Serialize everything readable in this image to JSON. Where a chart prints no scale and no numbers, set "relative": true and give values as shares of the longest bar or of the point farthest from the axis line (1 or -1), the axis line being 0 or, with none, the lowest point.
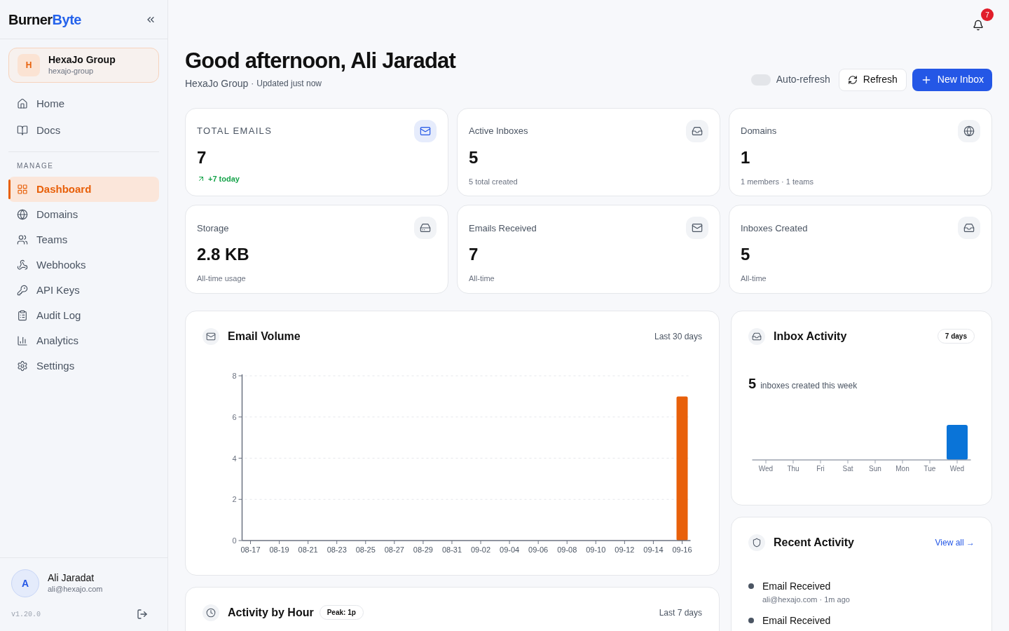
{
  "sidebar": {
    "logo": {
      "first": "Burner",
      "second": "Byte"
    },
    "org": {
      "initial": "H",
      "name": "HexaJo Group",
      "slug": "hexajo-group"
    },
    "top_items": [
      {
        "label": "Home",
        "selected": false
      },
      {
        "label": "Docs",
        "selected": false
      }
    ],
    "section_label": "MANAGE",
    "items": [
      {
        "label": "Dashboard",
        "selected": true
      },
      {
        "label": "Domains",
        "selected": false
      },
      {
        "label": "Teams",
        "selected": false
      },
      {
        "label": "Webhooks",
        "selected": false
      },
      {
        "label": "API Keys",
        "selected": false
      },
      {
        "label": "Audit Log",
        "selected": false
      },
      {
        "label": "Analytics",
        "selected": false
      },
      {
        "label": "Settings",
        "selected": false
      }
    ],
    "user": {
      "initial": "A",
      "name": "Ali Jaradat",
      "email": "ali@hexajo.com"
    },
    "version": "v1.20.0"
  },
  "notifications": {
    "count": "7"
  },
  "header": {
    "greeting": "Good afternoon, Ali Jaradat",
    "org": "HexaJo Group",
    "separator": "·",
    "updated": "Updated just now",
    "auto_refresh": {
      "label": "Auto-refresh",
      "on": false
    },
    "refresh_button": "Refresh",
    "new_inbox_button": "New Inbox"
  },
  "stats": [
    {
      "label": "TOTAL EMAILS",
      "value": "7",
      "sub": "+7 today",
      "kind": "trend",
      "highlighted": true
    },
    {
      "label": "Active Inboxes",
      "value": "5",
      "sub": "5 total created",
      "kind": "plain",
      "highlighted": false
    },
    {
      "label": "Domains",
      "value": "1",
      "sub": "1 members · 1 teams",
      "kind": "plain",
      "highlighted": false
    },
    {
      "label": "Storage",
      "value": "2.8 KB",
      "sub": "All-time usage",
      "kind": "plain",
      "highlighted": false
    },
    {
      "label": "Emails Received",
      "value": "7",
      "sub": "All-time",
      "kind": "plain",
      "highlighted": false
    },
    {
      "label": "Inboxes Created",
      "value": "5",
      "sub": "All-time",
      "kind": "plain",
      "highlighted": false
    }
  ],
  "email_volume": {
    "title": "Email Volume",
    "range": "Last 30 days",
    "chart_data": {
      "type": "bar",
      "categories": [
        "08-17",
        "08-19",
        "08-21",
        "08-23",
        "08-25",
        "08-27",
        "08-29",
        "08-31",
        "09-02",
        "09-04",
        "09-06",
        "09-08",
        "09-10",
        "09-12",
        "09-14",
        "09-16"
      ],
      "series": [
        {
          "color": "#e8600a",
          "values": [
            0,
            0,
            0,
            0,
            0,
            0,
            0,
            0,
            0,
            0,
            0,
            0,
            0,
            0,
            0,
            7
          ]
        }
      ],
      "ylim": [
        0,
        8
      ],
      "yticks": [
        0,
        2,
        4,
        6,
        8
      ],
      "grid": true
    }
  },
  "inbox_activity": {
    "title": "Inbox Activity",
    "badge": "7 days",
    "count": "5",
    "count_label": "inboxes created this week",
    "chart_data": {
      "type": "bar",
      "categories": [
        "Wed",
        "Thu",
        "Fri",
        "Sat",
        "Sun",
        "Mon",
        "Tue",
        "Wed"
      ],
      "series": [
        {
          "color": "#0a74d8",
          "values": [
            0,
            0,
            0,
            0,
            0,
            0,
            0,
            1
          ]
        }
      ],
      "relative": true
    }
  },
  "recent_activity": {
    "title": "Recent Activity",
    "link": "View all →",
    "items": [
      {
        "title": "Email Received",
        "detail": "ali@hexajo.com · 1m ago"
      },
      {
        "title": "Email Received"
      }
    ]
  },
  "activity_by_hour": {
    "title": "Activity by Hour",
    "badge": "Peak: 1p",
    "range": "Last 7 days"
  }
}
